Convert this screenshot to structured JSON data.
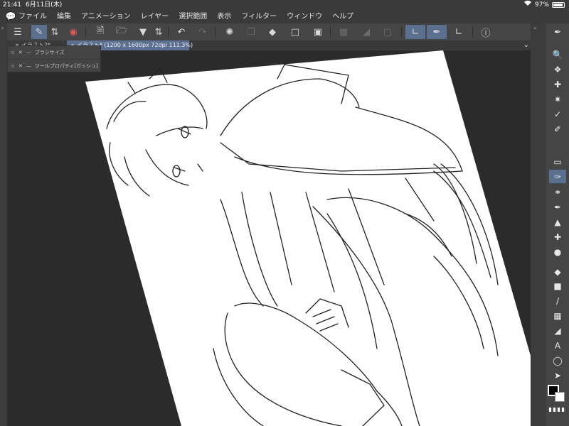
{
  "status_bar": {
    "time": "21:41",
    "date": "6月11日(木)",
    "battery_text": "97%",
    "battery_level": 0.97
  },
  "menu": {
    "items": [
      "ファイル",
      "編集",
      "アニメーション",
      "レイヤー",
      "選択範囲",
      "表示",
      "フィルター",
      "ウィンドウ",
      "ヘルプ"
    ]
  },
  "toolbar": {
    "icons": [
      "menu-icon",
      "tool-palette-icon",
      "stepper-icon",
      "app-icon",
      "new-canvas-icon",
      "open-folder-icon",
      "save-icon",
      "stepper-icon",
      "undo-icon",
      "redo-icon",
      "loading-icon",
      "copy-icon",
      "fill-icon",
      "select-rect-icon",
      "transform-icon",
      "clear-icon",
      "gradient-icon",
      "frame-icon",
      "snap-ruler-icon",
      "snap-pen-icon",
      "edit-ruler-icon",
      "help-icon"
    ]
  },
  "tabs": [
    {
      "label": "イラスト2*"
    },
    {
      "label": "イラスト* (1200 x 1600px 72dpi 111.3%)"
    }
  ],
  "floating_palette": {
    "rows": [
      "ブラシサイズ",
      "ツールプロパティ[ガッシュ]"
    ]
  },
  "tools": [
    "pen-icon",
    "zoom-icon",
    "move-layer-icon",
    "move-icon",
    "sparkle-icon",
    "eyedropper-icon",
    "pen-tool-icon",
    "eraser-icon",
    "brush-icon",
    "lasso-icon",
    "pen-nib-icon",
    "stamp-icon",
    "plus-icon",
    "drops-icon",
    "fill-bucket-icon",
    "gradient-icon",
    "line-icon",
    "frame-icon",
    "triangle-icon",
    "text-icon",
    "balloon-icon",
    "pointer-icon"
  ],
  "colors": {
    "accent": "#5b6f8f",
    "main_color": "#000000",
    "sub_color": "#ffffff"
  }
}
